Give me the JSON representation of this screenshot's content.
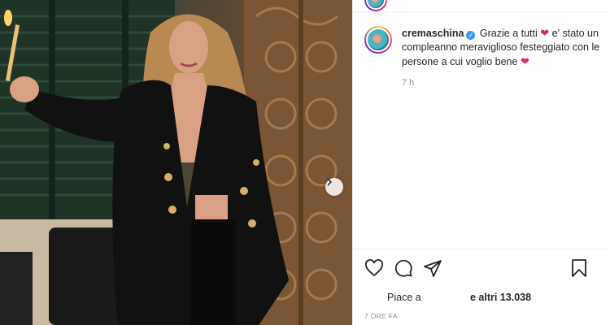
{
  "post": {
    "username": "cremaschina",
    "caption_before_heart": "Grazie a tutti",
    "caption_middle": "e' stato un compleanno meraviglioso festeggiato con le persone a cui voglio bene",
    "heart": "❤",
    "verified_mark": "✓",
    "comment_time": "7 h"
  },
  "likes": {
    "prefix": "Piace a",
    "suffix": "e altri 13.038"
  },
  "time_ago": "7 ORE FA",
  "colors": {
    "verified": "#3897f0",
    "heart": "#e0245e",
    "secondary_text": "#8e8e8e"
  },
  "icons": {
    "like": "heart-outline-icon",
    "comment": "speech-bubble-icon",
    "share": "paper-plane-icon",
    "save": "bookmark-icon",
    "next": "chevron-right-icon"
  }
}
